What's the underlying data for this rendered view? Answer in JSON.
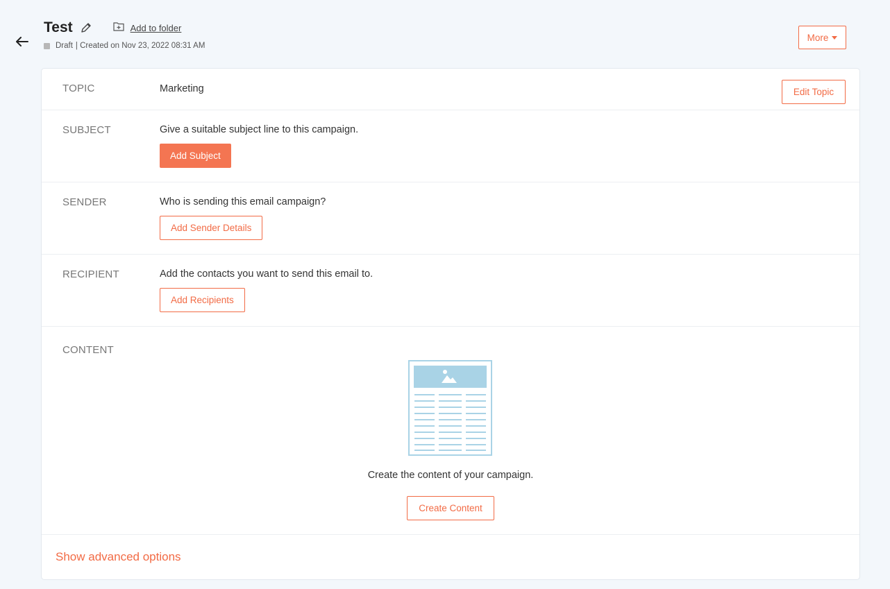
{
  "header": {
    "title": "Test",
    "add_to_folder": "Add to folder",
    "status": "Draft",
    "created": "| Created on Nov 23, 2022 08:31 AM",
    "more_label": "More"
  },
  "rows": {
    "topic": {
      "label": "TOPIC",
      "value": "Marketing",
      "button": "Edit Topic"
    },
    "subject": {
      "label": "SUBJECT",
      "text": "Give a suitable subject line to this campaign.",
      "button": "Add Subject"
    },
    "sender": {
      "label": "SENDER",
      "text": "Who is sending this email campaign?",
      "button": "Add Sender Details"
    },
    "recipient": {
      "label": "RECIPIENT",
      "text": "Add the contacts you want to send this email to.",
      "button": "Add Recipients"
    },
    "content": {
      "label": "CONTENT",
      "text": "Create the content of your campaign.",
      "button": "Create Content"
    }
  },
  "footer": {
    "advanced": "Show advanced options"
  },
  "colors": {
    "accent": "#f26b45",
    "accent_fill": "#f47552",
    "illustration": "#a9d3e6",
    "background": "#f3f7fb"
  }
}
